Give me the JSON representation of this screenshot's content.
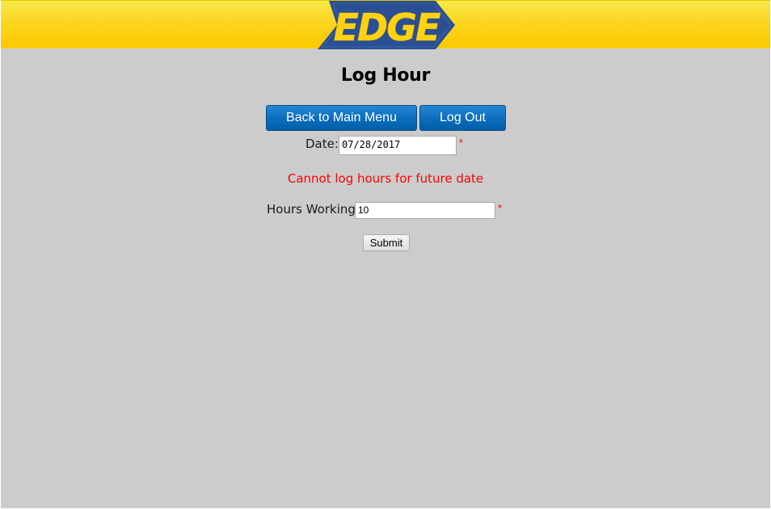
{
  "header": {
    "logo_text": "EDGE",
    "background_color": "#fcc800",
    "logo_color": "#2b4f93"
  },
  "page": {
    "title": "Log Hour"
  },
  "nav": {
    "main_menu_label": "Back to Main Menu",
    "logout_label": "Log Out",
    "button_color": "#0d6ebd"
  },
  "form": {
    "date_label": "Date:",
    "date_value": "07/28/2017",
    "required_marker": "*",
    "error_message": "Cannot log hours for future date",
    "error_color": "#ff0000",
    "hours_label": "Hours Working",
    "hours_value": "10",
    "submit_label": "Submit"
  }
}
